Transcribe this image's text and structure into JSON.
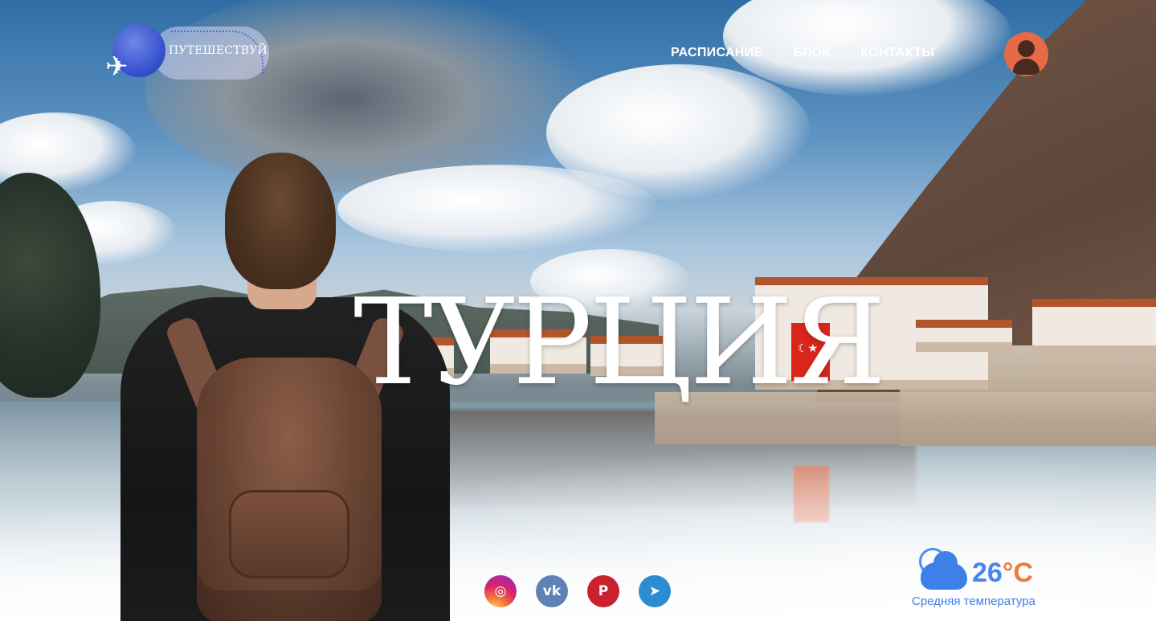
{
  "brand": {
    "logo_text": "ПУТЕШЕСТВУЙ"
  },
  "nav": {
    "items": [
      {
        "label": "РАСПИСАНИЕ"
      },
      {
        "label": "БЛОК"
      },
      {
        "label": "КОНТАКТЫ"
      }
    ]
  },
  "hero": {
    "title": "ТУРЦИЯ"
  },
  "social": {
    "items": [
      {
        "name": "instagram-icon",
        "glyph": "◎"
      },
      {
        "name": "vk-icon",
        "glyph": "vk"
      },
      {
        "name": "pinterest-icon",
        "glyph": "P"
      },
      {
        "name": "telegram-icon",
        "glyph": "➤"
      }
    ]
  },
  "weather": {
    "icon": "partly-cloudy-icon",
    "temperature": "26",
    "unit": "°C",
    "label": "Средняя температура"
  },
  "colors": {
    "accent": "#e56a45",
    "weather_blue": "#3f7fe8",
    "logo_blue": "#3a55d0"
  }
}
